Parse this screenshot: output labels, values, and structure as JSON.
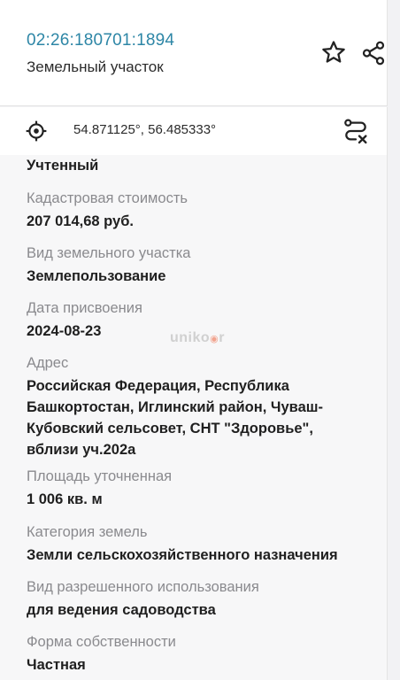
{
  "header": {
    "cadastral_number": "02:26:180701:1894",
    "object_type": "Земельный участок",
    "icons": {
      "favorite": "star-icon",
      "share": "share-icon"
    }
  },
  "coordinates": {
    "text": "54.871125°, 56.485333°",
    "icons": {
      "locate": "crosshair-icon",
      "route": "route-cancel-icon"
    }
  },
  "details": {
    "status_value": "Учтенный",
    "cadastral_value_label": "Кадастровая стоимость",
    "cadastral_value": "207 014,68 руб.",
    "land_kind_label": "Вид земельного участка",
    "land_kind": "Землепользование",
    "assigned_date_label": "Дата присвоения",
    "assigned_date": "2024-08-23",
    "address_label": "Адрес",
    "address": "Российская Федерация, Республика Башкортостан, Иглинский район, Чуваш-Кубовский сельсовет, СНТ \"Здоровье\", вблизи уч.202а",
    "area_label": "Площадь уточненная",
    "area": "1 006 кв. м",
    "land_category_label": "Категория земель",
    "land_category": "Земли сельскохозяйственного назначения",
    "permitted_use_label": "Вид разрешенного использования",
    "permitted_use": "для ведения садоводства",
    "ownership_label": "Форма собственности",
    "ownership": "Частная"
  },
  "watermark": {
    "text_left": "uniko",
    "text_right": "r"
  },
  "colors": {
    "accent": "#2d86a6",
    "label": "#8a8a8e",
    "value": "#1f1f1f",
    "background": "#f7f7f8"
  }
}
